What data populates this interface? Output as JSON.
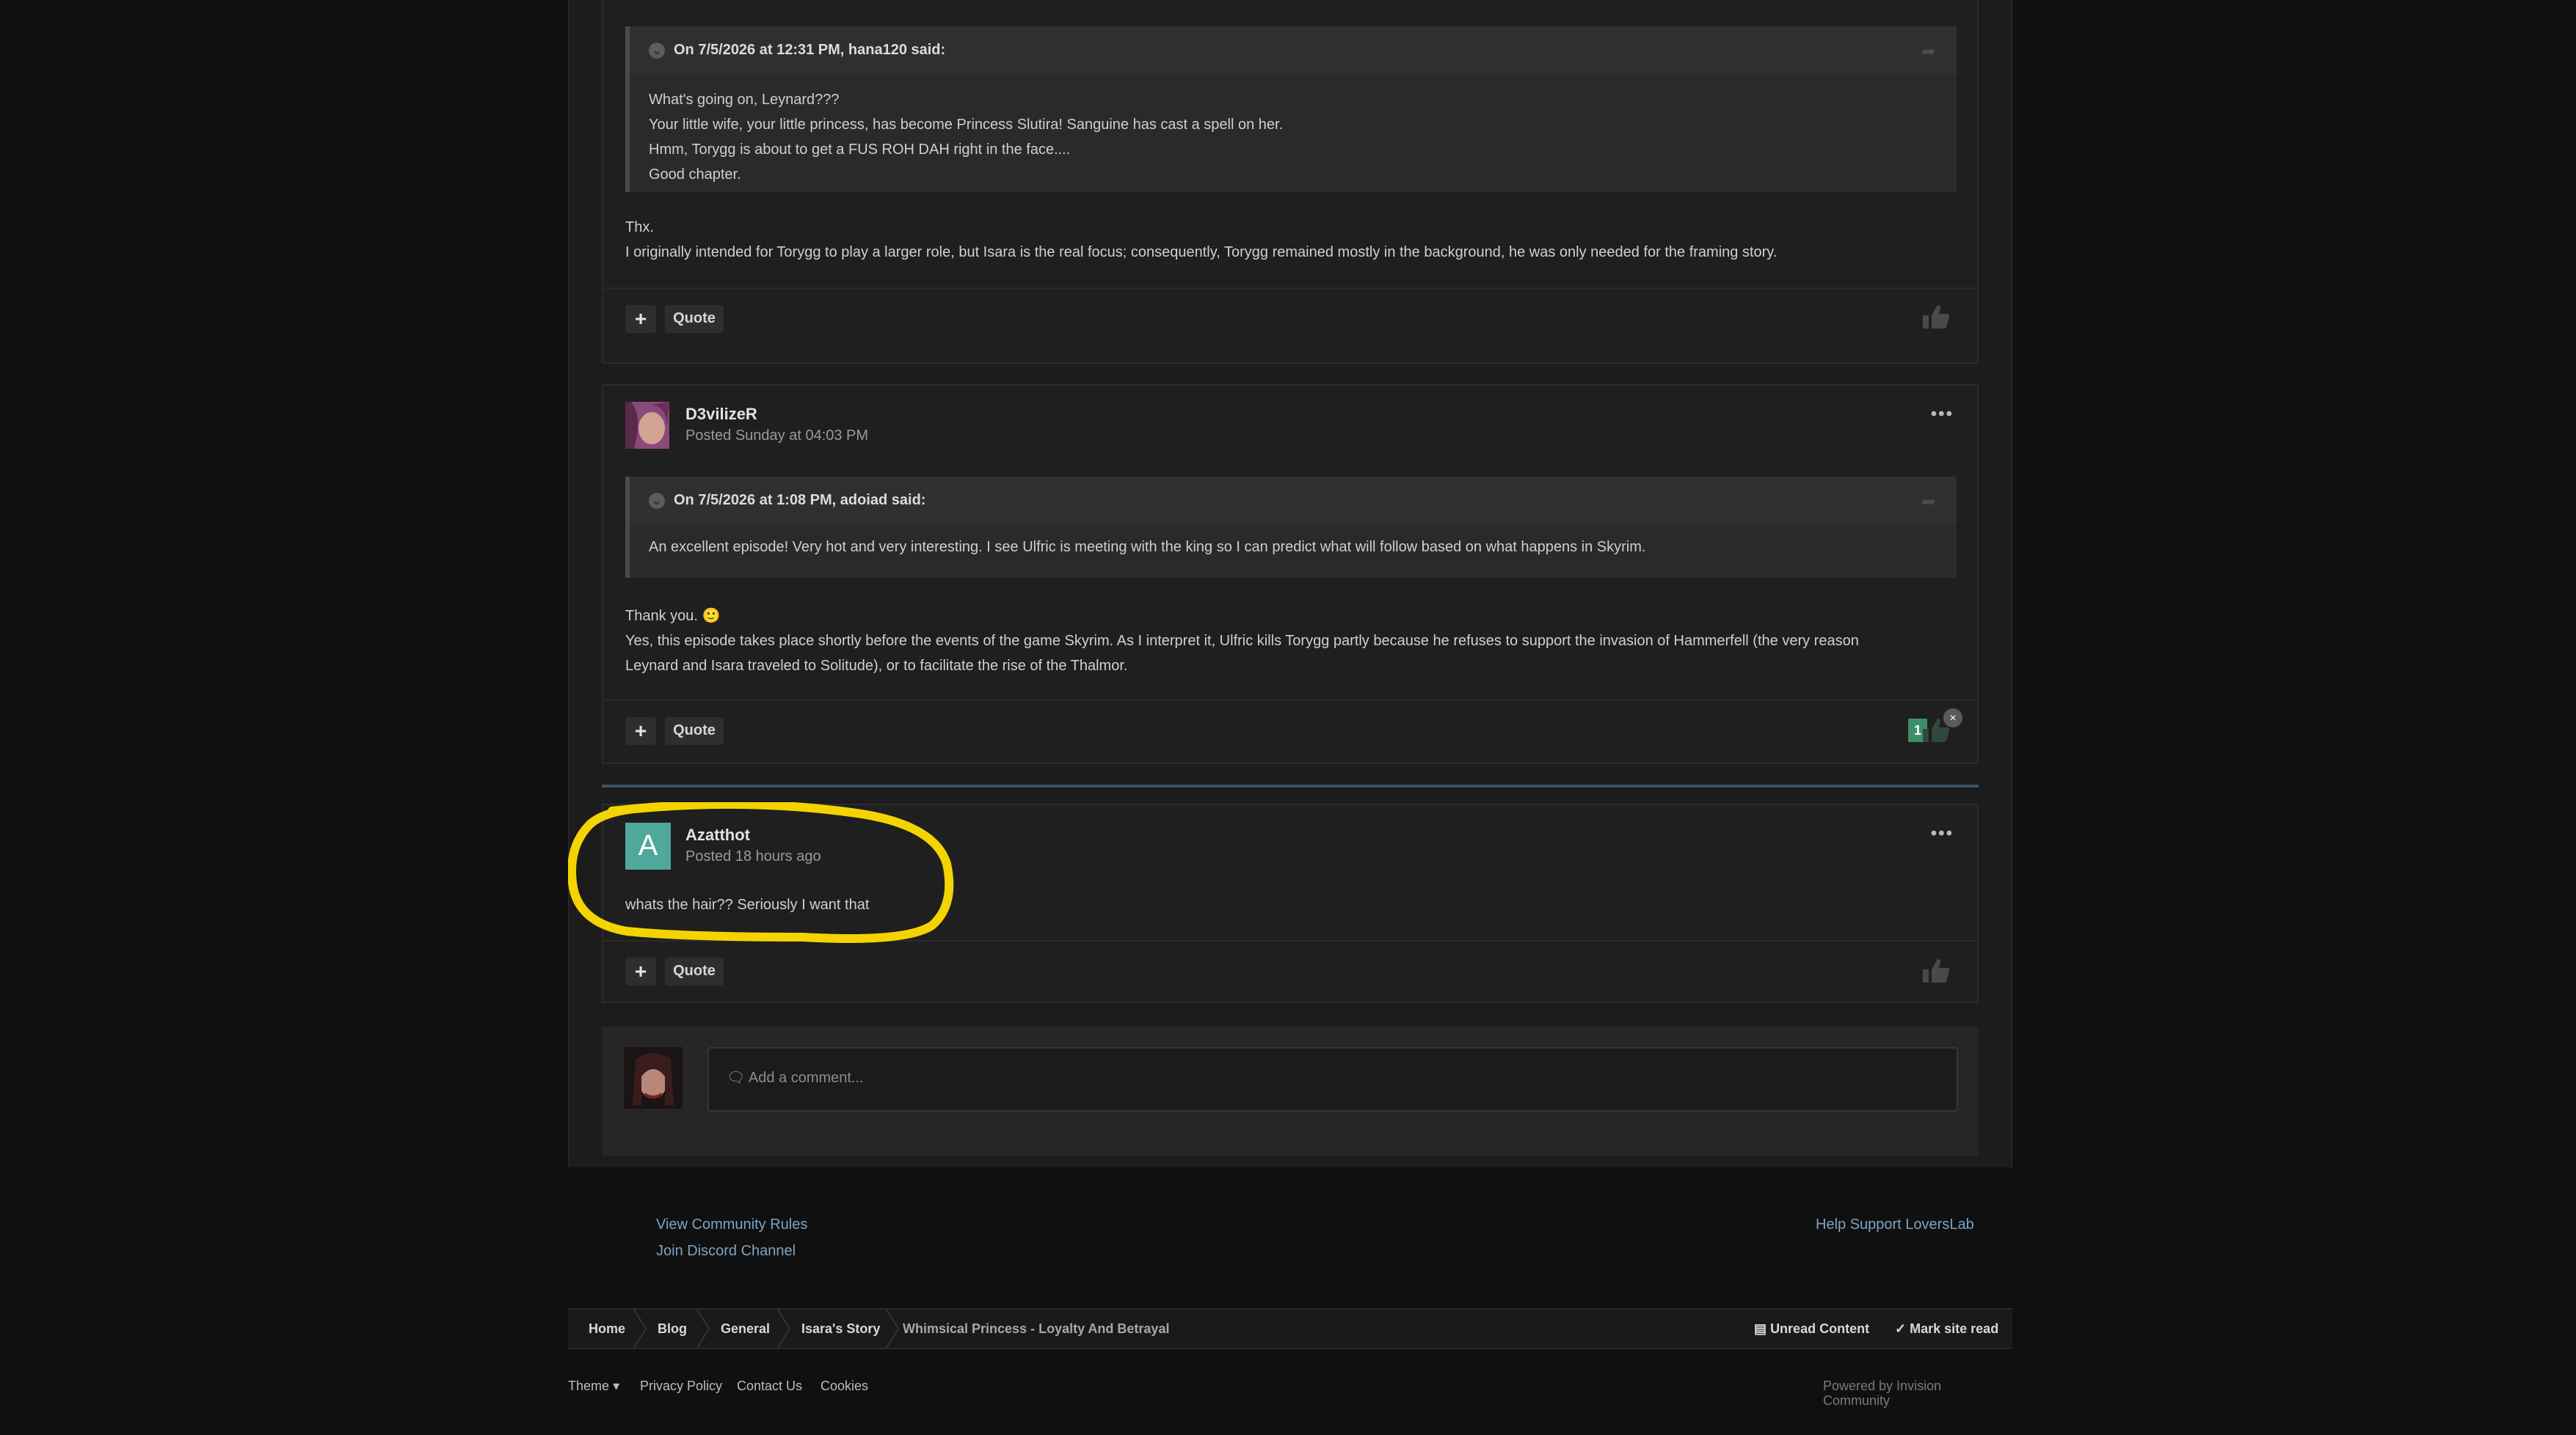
{
  "post1": {
    "quote_header": "On 7/5/2026 at 12:31 PM, hana120 said:",
    "quote_lines": [
      "What's going on, Leynard???",
      "Your little wife, your little princess, has become Princess Slutira! Sanguine has cast a spell on her.",
      "Hmm, Torygg is about to get a FUS ROH DAH right in the face....",
      "Good chapter."
    ],
    "body_lines": [
      "Thx.",
      "I originally intended for Torygg to play a larger role, but Isara is the real focus; consequently, Torygg remained mostly in the background, he was only needed for the framing story."
    ]
  },
  "post2": {
    "author": "D3vilizeR",
    "posted": "Posted Sunday at 04:03 PM",
    "quote_header": "On 7/5/2026 at 1:08 PM, adoiad said:",
    "quote_lines": [
      "An excellent episode! Very hot and very interesting. I see Ulfric is meeting with the king so I can predict what will follow based on what happens in Skyrim."
    ],
    "body_lines": [
      "Thank you. 🙂",
      "Yes, this episode takes place shortly before the events of the game Skyrim. As I interpret it, Ulfric kills Torygg partly because he refuses to support the invasion of Hammerfell (the very reason",
      "Leynard and Isara traveled to Solitude), or to facilitate the rise of the Thalmor."
    ],
    "reputation": "1"
  },
  "post3": {
    "avatar_letter": "A",
    "author": "Azatthot",
    "posted": "Posted 18 hours ago",
    "body": "whats the hair?? Seriously I want that"
  },
  "actions": {
    "plus": "+",
    "quote": "Quote",
    "menu": "•••",
    "close": "×"
  },
  "comment": {
    "placeholder": "Add a comment..."
  },
  "footer_links": {
    "rules": "View Community Rules",
    "discord": "Join Discord Channel",
    "support": "Help Support LoversLab"
  },
  "breadcrumb": [
    "Home",
    "Blog",
    "General",
    "Isara's Story",
    "Whimsical Princess - Loyalty And Betrayal"
  ],
  "breadcrumb_right": {
    "unread": "Unread Content",
    "mark_read": "Mark site read"
  },
  "bottom": {
    "theme": "Theme",
    "privacy": "Privacy Policy",
    "contact": "Contact Us",
    "cookies": "Cookies",
    "powered": "Powered by Invision Community"
  },
  "colors": {
    "highlight": "#f4d400",
    "accent_link": "#7da3c4",
    "rep_badge": "#3e8e6a",
    "avatar_letter_bg": "#4fa89a"
  }
}
